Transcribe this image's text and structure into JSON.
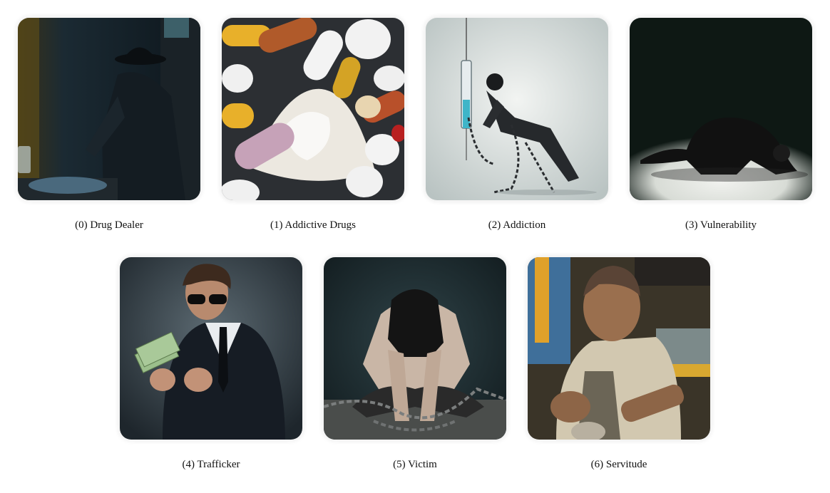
{
  "figures": [
    {
      "caption": "(0) Drug Dealer",
      "icon": "drug-dealer-image"
    },
    {
      "caption": "(1) Addictive Drugs",
      "icon": "pills-powder-image"
    },
    {
      "caption": "(2) Addiction",
      "icon": "chained-person-syringe-image"
    },
    {
      "caption": "(3) Vulnerability",
      "icon": "crouching-person-image"
    },
    {
      "caption": "(4) Trafficker",
      "icon": "suited-man-money-image"
    },
    {
      "caption": "(5) Victim",
      "icon": "chained-victim-image"
    },
    {
      "caption": "(6) Servitude",
      "icon": "laborer-image"
    }
  ]
}
